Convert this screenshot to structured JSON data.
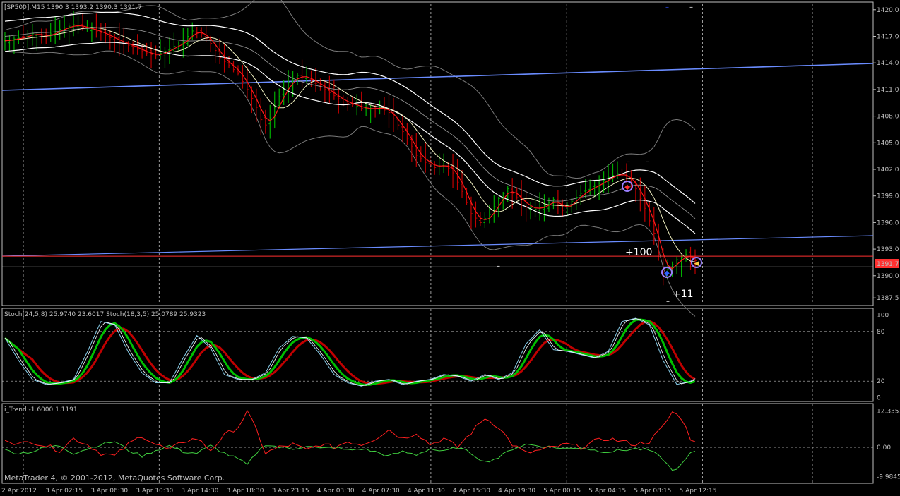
{
  "chart_data": [
    {
      "type": "ohlc",
      "title": "[SP500],M15  1390.3 1393.2 1390.3 1391.7",
      "price_labels": [
        "1420.0",
        "1417.0",
        "1414.0",
        "1411.0",
        "1408.0",
        "1405.0",
        "1402.0",
        "1399.0",
        "1396.0",
        "1393.0",
        "1390.0",
        "1387.5"
      ],
      "price_values": [
        1420.0,
        1417.0,
        1414.0,
        1411.0,
        1408.0,
        1405.0,
        1402.0,
        1399.0,
        1396.0,
        1393.0,
        1390.0,
        1387.5
      ],
      "ylim": [
        1386.8,
        1420.7
      ],
      "current_price": "1391.7",
      "current_value": 1391.7,
      "bid_line": 1392.2,
      "annotations": [
        "+100",
        "+11"
      ],
      "close_path": [
        [
          0,
          1416.5
        ],
        [
          3,
          1416.8
        ],
        [
          6,
          1417.3
        ],
        [
          9,
          1417.0
        ],
        [
          12,
          1417.8
        ],
        [
          15,
          1418.3
        ],
        [
          18,
          1417.9
        ],
        [
          21,
          1417.4
        ],
        [
          24,
          1416.6
        ],
        [
          27,
          1416.0
        ],
        [
          30,
          1415.3
        ],
        [
          33,
          1414.8
        ],
        [
          36,
          1415.6
        ],
        [
          39,
          1416.4
        ],
        [
          41,
          1417.6
        ],
        [
          43,
          1417.3
        ],
        [
          45,
          1416.2
        ],
        [
          47,
          1414.6
        ],
        [
          49,
          1413.7
        ],
        [
          51,
          1412.8
        ],
        [
          53,
          1411.0
        ],
        [
          55,
          1409.0
        ],
        [
          56,
          1407.6
        ],
        [
          57,
          1407.0
        ],
        [
          58,
          1407.8
        ],
        [
          60,
          1410.2
        ],
        [
          62,
          1411.8
        ],
        [
          64,
          1412.6
        ],
        [
          66,
          1412.3
        ],
        [
          68,
          1411.7
        ],
        [
          70,
          1411.0
        ],
        [
          72,
          1410.3
        ],
        [
          74,
          1409.6
        ],
        [
          76,
          1409.3
        ],
        [
          78,
          1408.9
        ],
        [
          80,
          1408.8
        ],
        [
          82,
          1409.0
        ],
        [
          84,
          1408.4
        ],
        [
          86,
          1407.0
        ],
        [
          88,
          1405.5
        ],
        [
          90,
          1403.6
        ],
        [
          92,
          1402.8
        ],
        [
          94,
          1402.2
        ],
        [
          96,
          1402.6
        ],
        [
          98,
          1401.6
        ],
        [
          100,
          1399.5
        ],
        [
          102,
          1397.0
        ],
        [
          104,
          1396.0
        ],
        [
          106,
          1396.9
        ],
        [
          108,
          1398.7
        ],
        [
          110,
          1399.8
        ],
        [
          112,
          1398.8
        ],
        [
          114,
          1397.8
        ],
        [
          116,
          1397.5
        ],
        [
          118,
          1397.9
        ],
        [
          120,
          1398.6
        ],
        [
          122,
          1397.4
        ],
        [
          124,
          1398.4
        ],
        [
          126,
          1399.3
        ],
        [
          128,
          1399.9
        ],
        [
          130,
          1400.4
        ],
        [
          132,
          1401.1
        ],
        [
          134,
          1401.5
        ],
        [
          136,
          1401.2
        ],
        [
          138,
          1399.8
        ],
        [
          140,
          1397.6
        ],
        [
          142,
          1394.8
        ],
        [
          143,
          1392.5
        ],
        [
          144,
          1390.4
        ],
        [
          145,
          1390.7
        ],
        [
          147,
          1391.8
        ],
        [
          149,
          1392.4
        ],
        [
          151,
          1391.7
        ]
      ],
      "candle_count": 152
    },
    {
      "type": "line",
      "title": "Stoch(24,5,8) 25.9740 23.6017  Stoch(18,3,5) 25.0789 25.9323",
      "levels": [
        "100",
        "80",
        "20",
        "0"
      ],
      "level_values": [
        100,
        80,
        20,
        0
      ],
      "ylim": [
        -2,
        102
      ],
      "main_path": [
        [
          0,
          72
        ],
        [
          3,
          45
        ],
        [
          6,
          22
        ],
        [
          9,
          16
        ],
        [
          12,
          18
        ],
        [
          15,
          22
        ],
        [
          18,
          55
        ],
        [
          21,
          92
        ],
        [
          24,
          88
        ],
        [
          27,
          55
        ],
        [
          30,
          30
        ],
        [
          33,
          18
        ],
        [
          36,
          18
        ],
        [
          39,
          48
        ],
        [
          42,
          75
        ],
        [
          45,
          60
        ],
        [
          48,
          28
        ],
        [
          51,
          22
        ],
        [
          54,
          22
        ],
        [
          57,
          30
        ],
        [
          60,
          60
        ],
        [
          63,
          74
        ],
        [
          66,
          72
        ],
        [
          69,
          52
        ],
        [
          72,
          28
        ],
        [
          75,
          18
        ],
        [
          78,
          14
        ],
        [
          81,
          20
        ],
        [
          84,
          22
        ],
        [
          87,
          16
        ],
        [
          90,
          20
        ],
        [
          93,
          22
        ],
        [
          96,
          28
        ],
        [
          99,
          26
        ],
        [
          102,
          20
        ],
        [
          105,
          28
        ],
        [
          108,
          22
        ],
        [
          111,
          30
        ],
        [
          114,
          65
        ],
        [
          117,
          82
        ],
        [
          120,
          58
        ],
        [
          123,
          56
        ],
        [
          126,
          52
        ],
        [
          129,
          48
        ],
        [
          132,
          56
        ],
        [
          135,
          92
        ],
        [
          138,
          96
        ],
        [
          141,
          88
        ],
        [
          144,
          45
        ],
        [
          147,
          16
        ],
        [
          150,
          20
        ],
        [
          152,
          26
        ]
      ],
      "signal_offset": 2
    },
    {
      "type": "line",
      "title": "i_Trend -1.6000 1.1191",
      "levels": [
        "12.3351",
        "0.00",
        "-9.9845"
      ],
      "level_values": [
        12.3351,
        0,
        -9.9845
      ],
      "ylim": [
        -10.8,
        13.2
      ],
      "red_path": [
        [
          0,
          3
        ],
        [
          3,
          1
        ],
        [
          6,
          2
        ],
        [
          9,
          0.5
        ],
        [
          12,
          -1
        ],
        [
          15,
          3
        ],
        [
          18,
          1
        ],
        [
          21,
          -2
        ],
        [
          24,
          -3
        ],
        [
          27,
          1
        ],
        [
          30,
          4
        ],
        [
          33,
          1
        ],
        [
          36,
          -1
        ],
        [
          39,
          2
        ],
        [
          42,
          3
        ],
        [
          45,
          -1
        ],
        [
          48,
          4
        ],
        [
          51,
          7
        ],
        [
          53,
          12
        ],
        [
          55,
          6
        ],
        [
          57,
          -2
        ],
        [
          60,
          0
        ],
        [
          63,
          1
        ],
        [
          66,
          -1
        ],
        [
          69,
          1
        ],
        [
          72,
          0
        ],
        [
          75,
          2
        ],
        [
          78,
          1
        ],
        [
          81,
          3
        ],
        [
          84,
          6
        ],
        [
          87,
          3
        ],
        [
          90,
          5
        ],
        [
          93,
          1
        ],
        [
          96,
          3
        ],
        [
          99,
          0
        ],
        [
          102,
          5
        ],
        [
          105,
          10
        ],
        [
          108,
          7
        ],
        [
          111,
          1
        ],
        [
          114,
          -2
        ],
        [
          117,
          -1
        ],
        [
          120,
          0
        ],
        [
          123,
          1
        ],
        [
          126,
          0
        ],
        [
          129,
          2
        ],
        [
          132,
          3
        ],
        [
          135,
          2
        ],
        [
          138,
          1
        ],
        [
          141,
          2
        ],
        [
          144,
          7
        ],
        [
          146,
          12
        ],
        [
          148,
          10
        ],
        [
          150,
          3
        ],
        [
          152,
          2
        ]
      ],
      "green_path": [
        [
          0,
          -1
        ],
        [
          3,
          -2
        ],
        [
          6,
          -1.5
        ],
        [
          9,
          0
        ],
        [
          12,
          0.5
        ],
        [
          15,
          -2
        ],
        [
          18,
          -0.5
        ],
        [
          21,
          1
        ],
        [
          24,
          2
        ],
        [
          27,
          -1
        ],
        [
          30,
          -3
        ],
        [
          33,
          -1
        ],
        [
          36,
          0.5
        ],
        [
          39,
          -1.5
        ],
        [
          42,
          -2
        ],
        [
          45,
          0.5
        ],
        [
          48,
          -2
        ],
        [
          51,
          -4
        ],
        [
          53,
          -6
        ],
        [
          55,
          -2
        ],
        [
          57,
          1
        ],
        [
          60,
          0
        ],
        [
          63,
          -0.5
        ],
        [
          66,
          0.5
        ],
        [
          69,
          -0.5
        ],
        [
          72,
          0
        ],
        [
          75,
          -1
        ],
        [
          78,
          -0.5
        ],
        [
          81,
          -1.5
        ],
        [
          84,
          -3
        ],
        [
          87,
          -1.5
        ],
        [
          90,
          -2.5
        ],
        [
          93,
          -0.5
        ],
        [
          96,
          -1.5
        ],
        [
          99,
          0
        ],
        [
          102,
          -2
        ],
        [
          105,
          -5
        ],
        [
          108,
          -3.5
        ],
        [
          111,
          -0.5
        ],
        [
          114,
          1
        ],
        [
          117,
          0.5
        ],
        [
          120,
          0
        ],
        [
          123,
          -0.5
        ],
        [
          126,
          0
        ],
        [
          129,
          -1
        ],
        [
          132,
          -1.5
        ],
        [
          135,
          -1
        ],
        [
          138,
          -0.5
        ],
        [
          141,
          -1
        ],
        [
          144,
          -4
        ],
        [
          146,
          -8
        ],
        [
          148,
          -6
        ],
        [
          150,
          -2
        ],
        [
          152,
          -1.5
        ]
      ]
    }
  ],
  "x_axis": {
    "tick_labels": [
      "2 Apr 2012",
      "3 Apr 02:15",
      "3 Apr 06:30",
      "3 Apr 10:30",
      "3 Apr 14:30",
      "3 Apr 18:30",
      "3 Apr 23:15",
      "4 Apr 03:30",
      "4 Apr 07:30",
      "4 Apr 11:30",
      "4 Apr 15:30",
      "4 Apr 19:30",
      "5 Apr 00:15",
      "5 Apr 04:15",
      "5 Apr 08:15",
      "5 Apr 12:15"
    ]
  },
  "footer_text": "MetaTrader 4, © 2001-2012, MetaQuotes Software Corp.",
  "colors": {
    "background": "#000000",
    "grid": "#c0c0c0",
    "bull_bar": "#00b000",
    "bear_bar": "#c00000",
    "fast_ma": "#ff1a1a",
    "envelope": "#ffffff",
    "bollinger": "#7a7a7a",
    "trendline": "#6a8cff",
    "stoch_main": "#87ceeb",
    "stoch_signal_a": "#00c000",
    "stoch_signal_b": "#c00000",
    "trend_red": "#ff2020",
    "trend_green": "#40d040",
    "current_price_bg": "#ff3030"
  }
}
